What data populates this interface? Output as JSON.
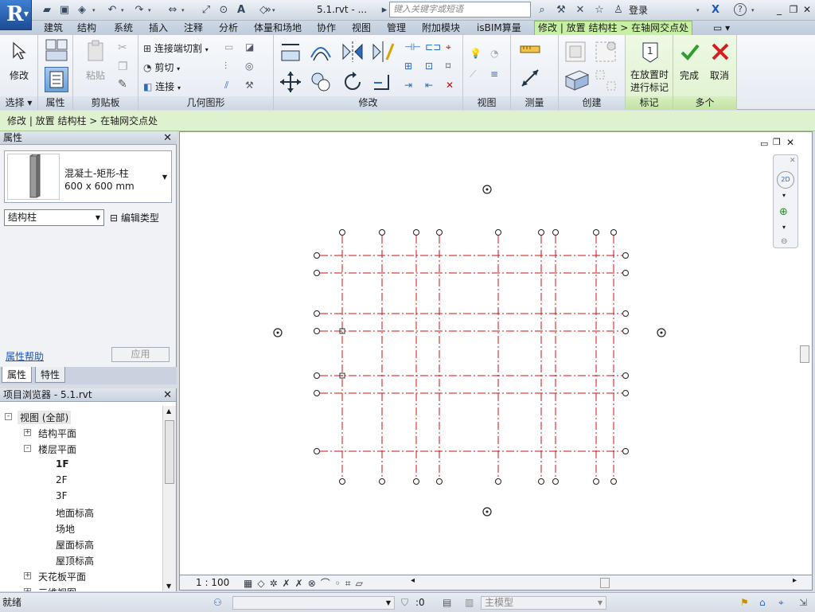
{
  "title_bar": {
    "app_letter": "R",
    "doc_title": "5.1.rvt - ...",
    "search_placeholder": "键入关键字或短语",
    "login_label": "登录",
    "help_label": "?"
  },
  "tabs": [
    "建筑",
    "结构",
    "系统",
    "插入",
    "注释",
    "分析",
    "体量和场地",
    "协作",
    "视图",
    "管理",
    "附加模块",
    "isBIM算量",
    "修改 | 放置 结构柱 > 在轴网交点处"
  ],
  "active_tab_index": 12,
  "ribbon": {
    "select_panel": {
      "button_label": "修改",
      "title": "选择"
    },
    "properties_panel": {
      "title": "属性"
    },
    "clipboard_panel": {
      "paste_label": "粘贴",
      "title": "剪贴板"
    },
    "geometry_panel": {
      "join_cut_label": "连接端切割",
      "cut_label": "剪切",
      "join_label": "连接",
      "title": "几何图形"
    },
    "modify_panel": {
      "title": "修改"
    },
    "view_panel": {
      "title": "视图"
    },
    "measure_panel": {
      "title": "测量"
    },
    "create_panel": {
      "title": "创建"
    },
    "tag_panel": {
      "tag_label_line1": "在放置时",
      "tag_label_line2": "进行标记",
      "title": "标记"
    },
    "multiple_panel": {
      "finish_label": "完成",
      "cancel_label": "取消",
      "title": "多个"
    }
  },
  "context_bar": "修改 | 放置 结构柱 > 在轴网交点处",
  "properties": {
    "header": "属性",
    "type_name_line1": "混凝土-矩形-柱",
    "type_name_line2": "600 x 600 mm",
    "filter_value": "结构柱",
    "edit_type_label": "编辑类型",
    "help_link": "属性帮助",
    "apply_label": "应用",
    "tabs": [
      "属性",
      "特性"
    ]
  },
  "project_browser": {
    "header": "项目浏览器 - 5.1.rvt",
    "nodes": [
      {
        "label": "视图 (全部)",
        "level": 0,
        "toggle": "-"
      },
      {
        "label": "结构平面",
        "level": 1,
        "toggle": "+"
      },
      {
        "label": "楼层平面",
        "level": 1,
        "toggle": "-"
      },
      {
        "label": "1F",
        "level": 2,
        "bold": true
      },
      {
        "label": "2F",
        "level": 2
      },
      {
        "label": "3F",
        "level": 2
      },
      {
        "label": "地面标高",
        "level": 2
      },
      {
        "label": "场地",
        "level": 2
      },
      {
        "label": "屋面标高",
        "level": 2
      },
      {
        "label": "屋顶标高",
        "level": 2
      },
      {
        "label": "天花板平面",
        "level": 1,
        "toggle": "+"
      },
      {
        "label": "三维视图",
        "level": 1,
        "toggle": "+"
      }
    ]
  },
  "view_bar": {
    "scale": "1 : 100"
  },
  "status_bar": {
    "status_text": "就绪",
    "filter_count": ":0",
    "model_label": "主模型"
  },
  "colors": {
    "grid_line": "#d01010",
    "accent_green": "#c8f0a4",
    "app_button": "#2a5fae"
  }
}
